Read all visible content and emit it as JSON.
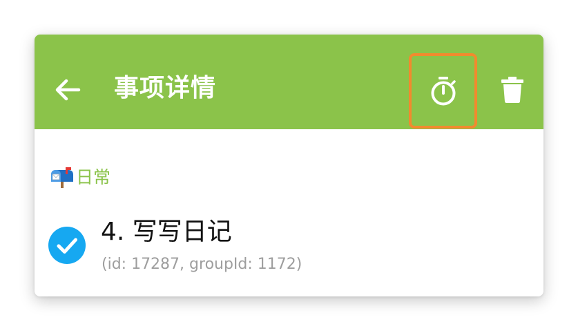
{
  "appbar": {
    "title": "事项详情",
    "back_icon": "arrow-left-icon",
    "timer_icon": "stopwatch-icon",
    "delete_icon": "trash-icon",
    "background_color": "#8bc34a",
    "highlight_color": "#f28a2e"
  },
  "category": {
    "icon": "mailbox-icon",
    "label": "日常",
    "color": "#8bc34a"
  },
  "item": {
    "completed": true,
    "check_color": "#16a8f1",
    "title": "4. 写写日记",
    "meta": "(id: 17287, groupId: 1172)"
  }
}
